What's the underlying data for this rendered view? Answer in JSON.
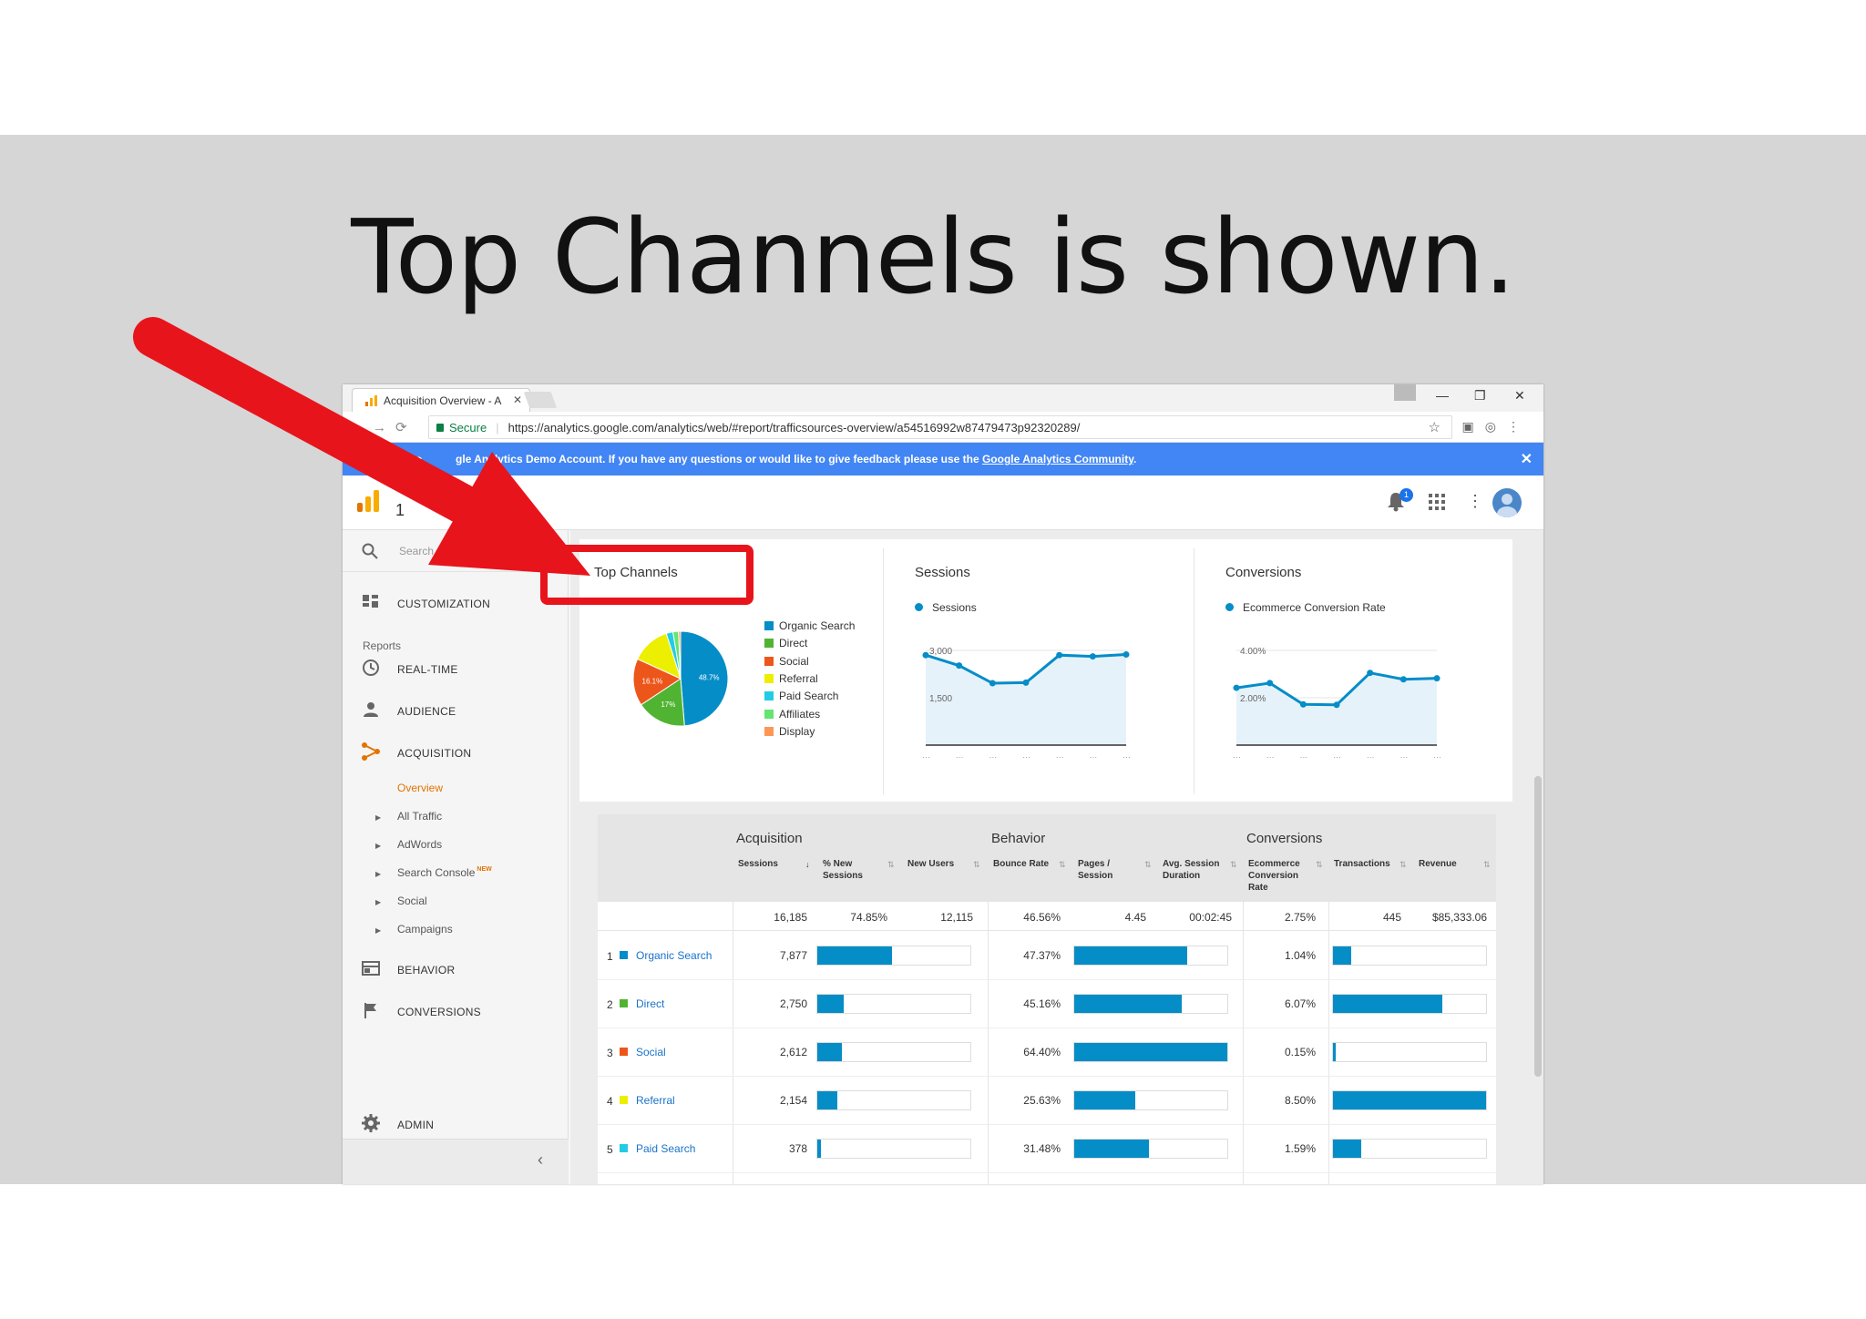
{
  "slide": {
    "title": "Top Channels is shown."
  },
  "browser": {
    "tab_title": "Acquisition Overview - A",
    "secure_label": "Secure",
    "url": "https://analytics.google.com/analytics/web/#report/trafficsources-overview/a54516992w87479473p92320289/"
  },
  "banner": {
    "text_start": "e to",
    "text_mid": "gle Analytics Demo Account. If you have any questions or would like to give feedback please use the",
    "link": "Google Analytics Community",
    "text_end": "."
  },
  "header": {
    "account_small": "re",
    "account_big": "1",
    "notification_count": "1"
  },
  "sidebar": {
    "search_placeholder": "Search reports and he",
    "customization": "CUSTOMIZATION",
    "reports_header": "Reports",
    "realtime": "REAL-TIME",
    "audience": "AUDIENCE",
    "acquisition": "ACQUISITION",
    "sub": {
      "overview": "Overview",
      "all_traffic": "All Traffic",
      "adwords": "AdWords",
      "search_console": "Search Console",
      "new_badge": "NEW",
      "social": "Social",
      "campaigns": "Campaigns"
    },
    "behavior": "BEHAVIOR",
    "conversions": "CONVERSIONS",
    "admin": "ADMIN"
  },
  "cards": {
    "top_channels": {
      "title": "Top Channels",
      "legend": [
        {
          "label": "Organic Search",
          "color": "#058dc7"
        },
        {
          "label": "Direct",
          "color": "#50b432"
        },
        {
          "label": "Social",
          "color": "#ed561b"
        },
        {
          "label": "Referral",
          "color": "#edef00"
        },
        {
          "label": "Paid Search",
          "color": "#24cbe5"
        },
        {
          "label": "Affiliates",
          "color": "#64e572"
        },
        {
          "label": "Display",
          "color": "#ff9655"
        }
      ]
    },
    "sessions": {
      "title": "Sessions",
      "series": "Sessions",
      "tick_high": "3,000",
      "tick_mid": "1,500"
    },
    "conversions": {
      "title": "Conversions",
      "series": "Ecommerce Conversion Rate",
      "tick_high": "4.00%",
      "tick_mid": "2.00%"
    }
  },
  "chart_data": [
    {
      "type": "pie",
      "categories": [
        "Organic Search",
        "Direct",
        "Social",
        "Referral",
        "Paid Search",
        "Affiliates",
        "Display"
      ],
      "values": [
        48.7,
        17,
        16.1,
        13.3,
        2.3,
        1.9,
        0.7
      ],
      "labels": [
        "48.7%",
        "17%",
        "16.1%"
      ]
    },
    {
      "type": "line",
      "series": [
        {
          "values": [
            2850,
            2520,
            1960,
            1980,
            2850,
            2810,
            2870
          ]
        }
      ],
      "ylim": [
        0,
        3000
      ],
      "y_ticks": [
        "3,000",
        "1,500"
      ]
    },
    {
      "type": "line",
      "series": [
        {
          "values": [
            2.42,
            2.62,
            1.72,
            1.7,
            3.05,
            2.78,
            2.82
          ]
        }
      ],
      "ylim": [
        0,
        4
      ],
      "y_ticks": [
        "4.00%",
        "2.00%"
      ]
    }
  ],
  "table": {
    "groups": {
      "acquisition": "Acquisition",
      "behavior": "Behavior",
      "conversions": "Conversions"
    },
    "columns": {
      "sessions": "Sessions",
      "new_sessions": "% New Sessions",
      "new_users": "New Users",
      "bounce_rate": "Bounce Rate",
      "pages_session": "Pages / Session",
      "avg_duration": "Avg. Session Duration",
      "ecr": "Ecommerce Conversion Rate",
      "transactions": "Transactions",
      "revenue": "Revenue"
    },
    "totals": {
      "sessions": "16,185",
      "new_sessions": "74.85%",
      "new_users": "12,115",
      "bounce_rate": "46.56%",
      "pages_session": "4.45",
      "avg_duration": "00:02:45",
      "ecr": "2.75%",
      "transactions": "445",
      "revenue": "$85,333.06"
    },
    "rows": [
      {
        "num": "1",
        "name": "Organic Search",
        "color": "#058dc7",
        "sessions": "7,877",
        "sessions_share": 0.487,
        "bounce": "47.37%",
        "bounce_share": 0.736,
        "ecr": "1.04%",
        "ecr_share": 0.122
      },
      {
        "num": "2",
        "name": "Direct",
        "color": "#50b432",
        "sessions": "2,750",
        "sessions_share": 0.17,
        "bounce": "45.16%",
        "bounce_share": 0.702,
        "ecr": "6.07%",
        "ecr_share": 0.714
      },
      {
        "num": "3",
        "name": "Social",
        "color": "#ed561b",
        "sessions": "2,612",
        "sessions_share": 0.161,
        "bounce": "64.40%",
        "bounce_share": 1.0,
        "ecr": "0.15%",
        "ecr_share": 0.018
      },
      {
        "num": "4",
        "name": "Referral",
        "color": "#edef00",
        "sessions": "2,154",
        "sessions_share": 0.133,
        "bounce": "25.63%",
        "bounce_share": 0.398,
        "ecr": "8.50%",
        "ecr_share": 1.0
      },
      {
        "num": "5",
        "name": "Paid Search",
        "color": "#24cbe5",
        "sessions": "378",
        "sessions_share": 0.023,
        "bounce": "31.48%",
        "bounce_share": 0.489,
        "ecr": "1.59%",
        "ecr_share": 0.187
      }
    ]
  },
  "annotation": {
    "color": "#e8141c"
  }
}
